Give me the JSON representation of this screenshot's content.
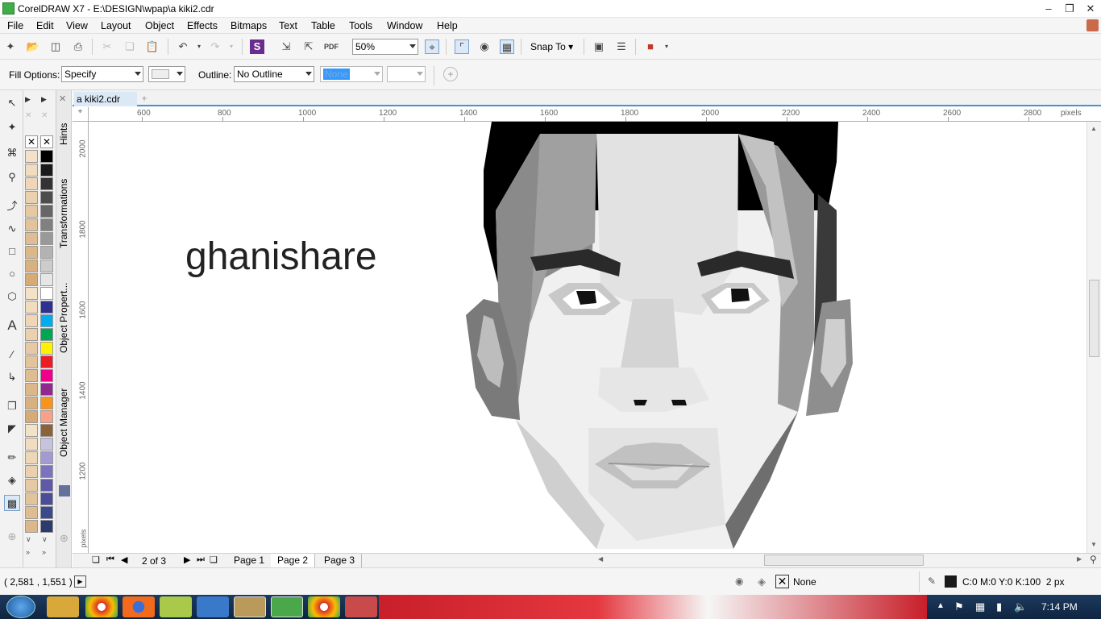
{
  "window": {
    "title": "CorelDRAW X7 - E:\\DESIGN\\wpap\\a kiki2.cdr"
  },
  "menu": [
    "File",
    "Edit",
    "View",
    "Layout",
    "Object",
    "Effects",
    "Bitmaps",
    "Text",
    "Table",
    "Tools",
    "Window",
    "Help"
  ],
  "toolbar": {
    "zoom": "50%",
    "snap_label": "Snap To"
  },
  "propbar": {
    "fill_label": "Fill Options:",
    "fill_value": "Specify",
    "outline_label": "Outline:",
    "outline_value": "No Outline",
    "width_value": "None"
  },
  "doc_tab": "a kiki2.cdr",
  "ruler": {
    "h_ticks": [
      "600",
      "800",
      "1000",
      "1200",
      "1400",
      "1600",
      "1800",
      "2000",
      "2200",
      "2400",
      "2600",
      "2800"
    ],
    "units": "pixels",
    "v_ticks": [
      "2000",
      "1800",
      "1600",
      "1400",
      "1200"
    ],
    "v_units": "pixels"
  },
  "dockers": [
    "Hints",
    "Transformations",
    "Object Propert...",
    "Object Manager"
  ],
  "canvas": {
    "text": "ghanishare"
  },
  "pager": {
    "count": "2 of 3",
    "pages": [
      "Page 1",
      "Page 2",
      "Page 3"
    ],
    "active": "Page 2"
  },
  "status": {
    "coords": "( 2,581 , 1,551 )",
    "fill": "None",
    "outline": "C:0 M:0 Y:0 K:100  2 px"
  },
  "taskbar": {
    "clock": "7:14 PM"
  },
  "colors": {
    "accent": "#4a90d9",
    "palette": [
      "#000000",
      "#1a1a1a",
      "#333333",
      "#4d4d4d",
      "#666666",
      "#808080",
      "#999999",
      "#b3b3b3",
      "#cccccc",
      "#e6e6e6",
      "#ffffff",
      "#2e3192",
      "#00aeef",
      "#00a651",
      "#fff200",
      "#ed1c24",
      "#ec008c",
      "#92278f",
      "#f7941d",
      "#f9a08b",
      "#8c6239",
      "#c7c2e0",
      "#a39ad1",
      "#7b73bf",
      "#5e5aa8",
      "#4b4d9b",
      "#3c4a8c",
      "#2d3a6e",
      "#262f5a"
    ]
  }
}
